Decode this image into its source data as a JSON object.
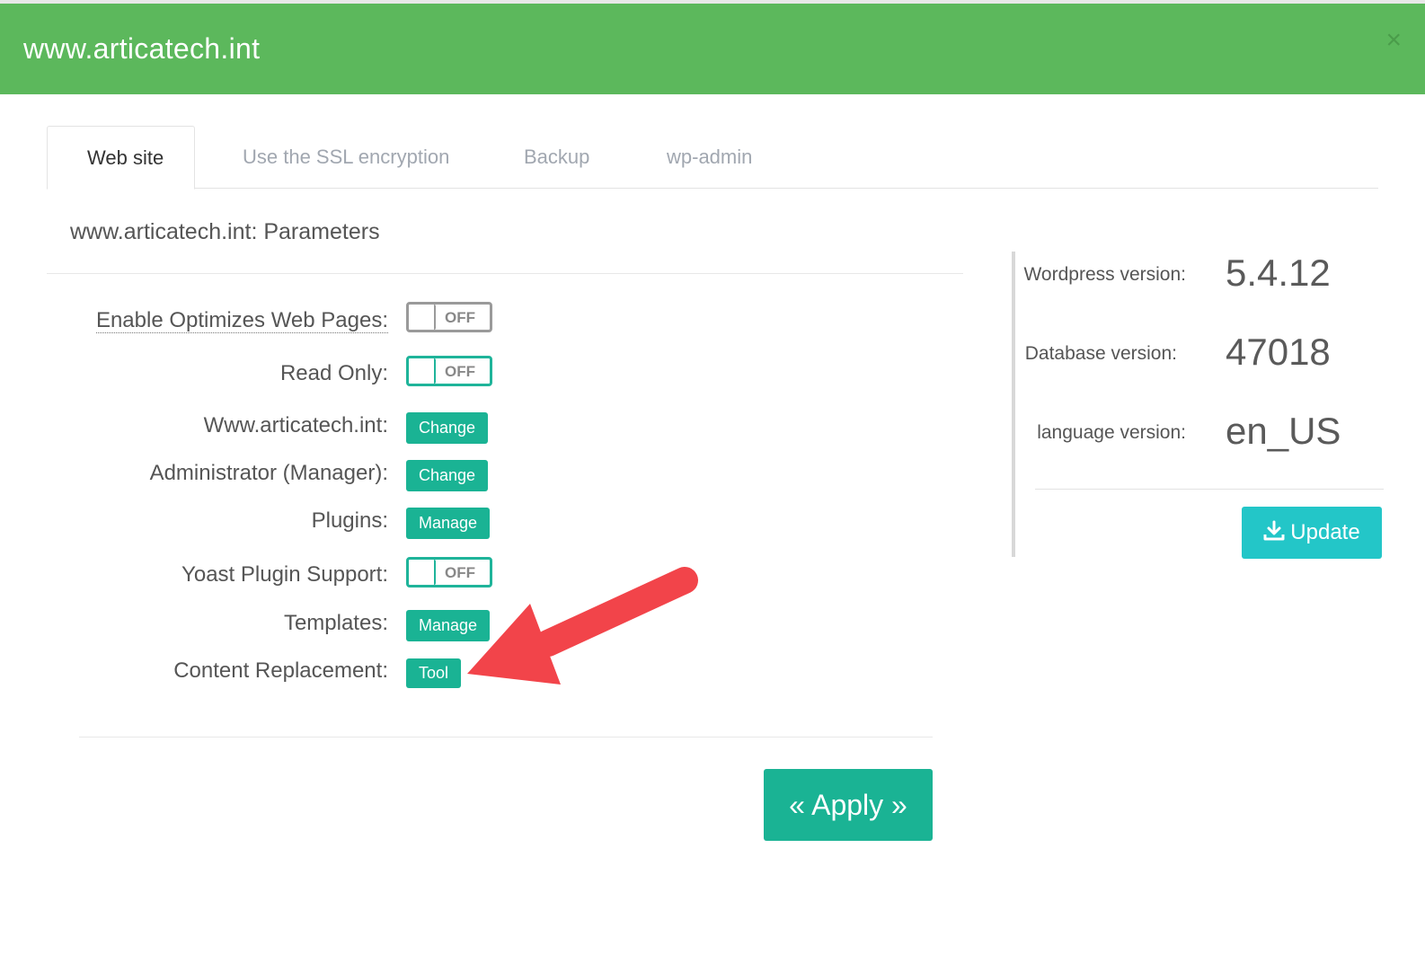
{
  "modal": {
    "title": "www.articatech.int",
    "close_symbol": "×"
  },
  "tabs": [
    {
      "label": "Web site",
      "active": true
    },
    {
      "label": "Use the SSL encryption",
      "active": false
    },
    {
      "label": "Backup",
      "active": false
    },
    {
      "label": "wp-admin",
      "active": false
    }
  ],
  "params": {
    "title": "www.articatech.int: Parameters",
    "rows": [
      {
        "label": "Enable Optimizes Web Pages:",
        "control": "toggle",
        "state": "OFF"
      },
      {
        "label": "Read Only:",
        "control": "toggle",
        "state": "OFF"
      },
      {
        "label": "Www.articatech.int:",
        "control": "button",
        "button_label": "Change"
      },
      {
        "label": "Administrator (Manager):",
        "control": "button",
        "button_label": "Change"
      },
      {
        "label": "Plugins:",
        "control": "button",
        "button_label": "Manage"
      },
      {
        "label": "Yoast Plugin Support:",
        "control": "toggle",
        "state": "OFF"
      },
      {
        "label": "Templates:",
        "control": "button",
        "button_label": "Manage"
      },
      {
        "label": "Content Replacement:",
        "control": "button",
        "button_label": "Tool"
      }
    ],
    "apply_label": "« Apply »"
  },
  "info": {
    "wordpress_label": "Wordpress version:",
    "wordpress_value": "5.4.12",
    "database_label": "Database version:",
    "database_value": "47018",
    "language_label": "language version:",
    "language_value": "en_US",
    "update_label": "Update",
    "update_icon": "download-icon"
  },
  "colors": {
    "header": "#5cb85c",
    "primary_button": "#1ab394",
    "update_button": "#23c6c8",
    "annotation_arrow": "#f2444a"
  }
}
